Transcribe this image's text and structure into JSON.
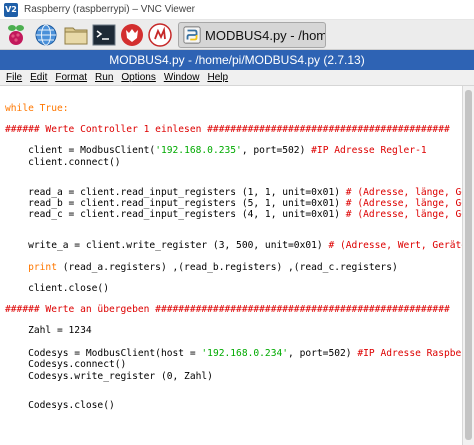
{
  "vnc": {
    "title": "Raspberry (raspberrypi) – VNC Viewer",
    "logo_text": "V2"
  },
  "taskbar": {
    "icons": [
      "raspberry-menu-icon",
      "web-browser-globe-icon",
      "file-manager-folder-icon",
      "terminal-icon",
      "wolfram-icon"
    ],
    "window_button_label": "MODBUS4.py - /hom..."
  },
  "editor": {
    "title": "MODBUS4.py - /home/pi/MODBUS4.py (2.7.13)",
    "menu": [
      "File",
      "Edit",
      "Format",
      "Run",
      "Options",
      "Window",
      "Help"
    ],
    "code": {
      "l01_kw": "while True:",
      "l02_cmt": "###### Werte Controller 1 einlesen ##########################################",
      "l03_a": "    client = ModbusClient(",
      "l03_str": "'192.168.0.235'",
      "l03_b": ", port=502) ",
      "l03_cmt": "#IP Adresse Regler-1",
      "l04": "    client.connect()",
      "l05_a": "    read_a = client.read_input_registers (1, 1, unit=0x01) ",
      "l05_cmt": "# (Adresse, länge, Ge",
      "l06_a": "    read_b = client.read_input_registers (5, 1, unit=0x01) ",
      "l06_cmt": "# (Adresse, länge, Ge",
      "l07_a": "    read_c = client.read_input_registers (4, 1, unit=0x01) ",
      "l07_cmt": "# (Adresse, länge, Ge",
      "l08_a": "    write_a = client.write_register (3, 500, unit=0x01) ",
      "l08_cmt": "# (Adresse, Wert, Geräte",
      "l09_kw": "    print",
      "l09_b": " (read_a.registers) ,(read_b.registers) ,(read_c.registers)",
      "l10": "    client.close()",
      "l11_cmt": "###### Werte an übergeben ###################################################",
      "l12": "    Zahl = 1234",
      "l13_a": "    Codesys = ModbusClient(host = ",
      "l13_str": "'192.168.0.234'",
      "l13_b": ", port=502) ",
      "l13_cmt": "#IP Adresse Raspber",
      "l14": "    Codesys.connect()",
      "l15": "    Codesys.write_register (0, Zahl)",
      "l16": "    Codesys.close()"
    }
  },
  "colors": {
    "editor_titlebar": "#2e63b4",
    "keyword": "#ff7700",
    "comment": "#dd0000",
    "string": "#00aa00"
  }
}
